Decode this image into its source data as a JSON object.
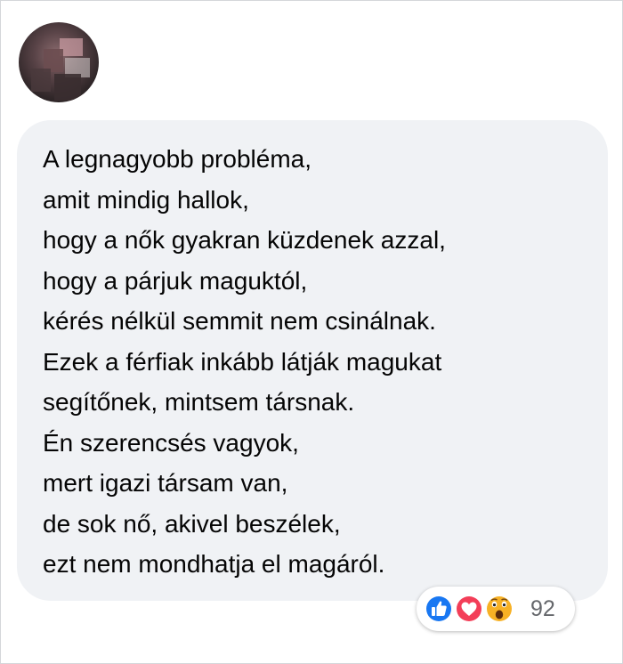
{
  "comment": {
    "lines": [
      "A legnagyobb probléma,",
      "amit mindig hallok,",
      "hogy a nők gyakran küzdenek azzal,",
      "hogy a párjuk maguktól,",
      "kérés nélkül semmit nem csinálnak.",
      "Ezek a férfiak inkább látják magukat",
      "segítőnek, mintsem társnak.",
      "Én szerencsés vagyok,",
      "mert igazi társam van,",
      "de sok nő, akivel beszélek,",
      "ezt nem mondhatja el magáról."
    ]
  },
  "reactions": {
    "icons": [
      "like-icon",
      "love-icon",
      "wow-icon"
    ],
    "count": "92"
  },
  "colors": {
    "bubble": "#f0f2f5",
    "text": "#050505",
    "like": "#1877f2",
    "love": "#f33e58",
    "wow": "#f7b125",
    "count": "#65676b"
  }
}
